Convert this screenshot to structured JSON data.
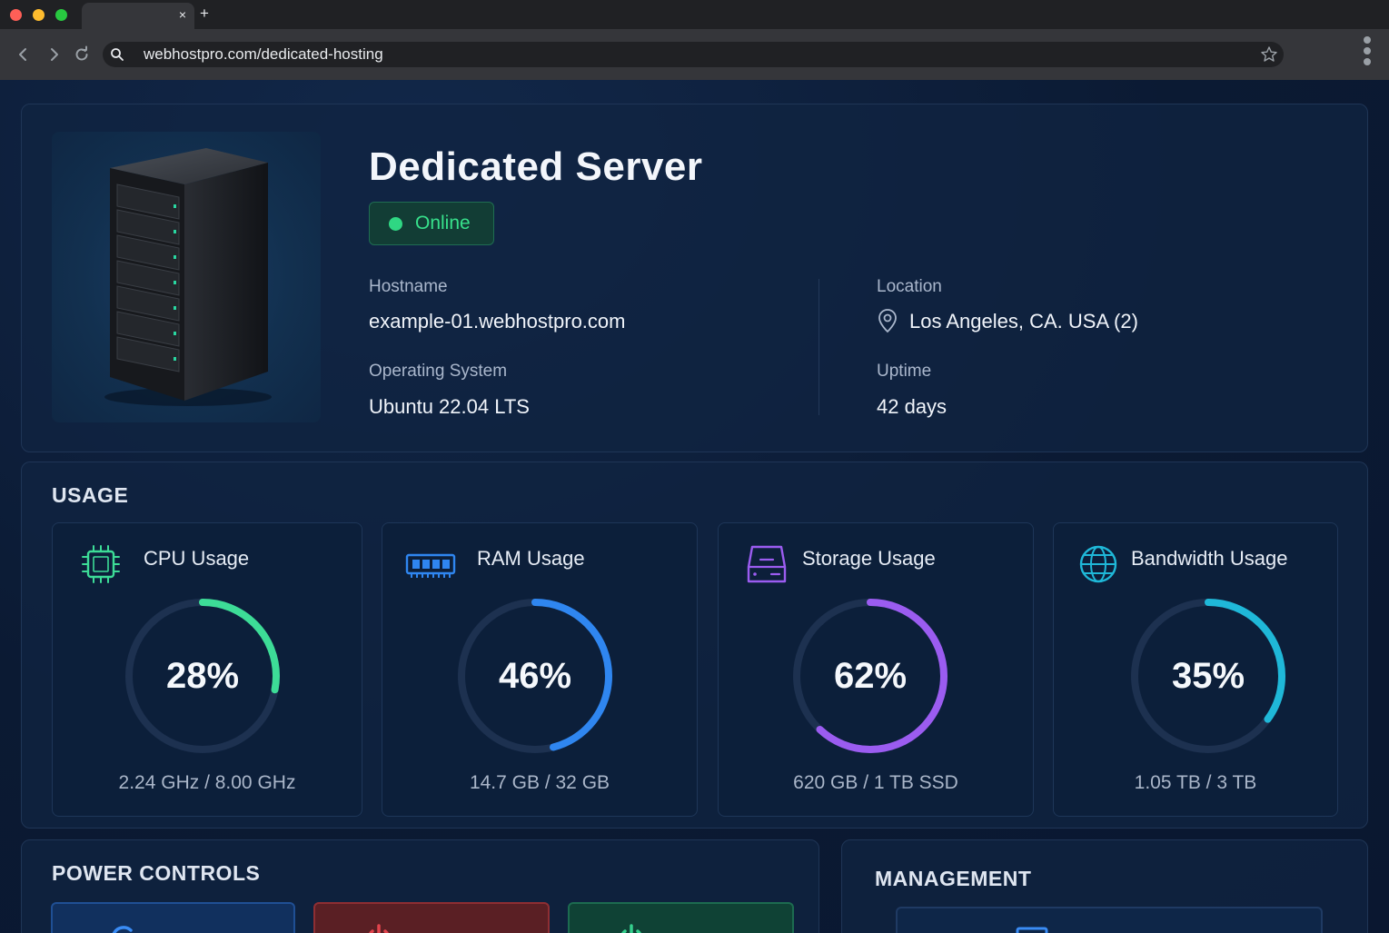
{
  "browser": {
    "tab_close": "×",
    "new_tab": "+",
    "url": "webhostpro.com/dedicated-hosting"
  },
  "server": {
    "title": "Dedicated Server",
    "status": "Online",
    "hostname_label": "Hostname",
    "hostname": "example-01.webhostpro.com",
    "os_label": "Operating System",
    "os": "Ubuntu 22.04 LTS",
    "location_label": "Location",
    "location": "Los Angeles, CA. USA (2)",
    "uptime_label": "Uptime",
    "uptime": "42 days"
  },
  "usage": {
    "title": "USAGE",
    "cards": [
      {
        "title": "CPU Usage",
        "percent_label": "28%",
        "fraction": 0.28,
        "detail": "2.24 GHz / 8.00 GHz",
        "color": "#3ddc97",
        "icon": "cpu-icon"
      },
      {
        "title": "RAM Usage",
        "percent_label": "46%",
        "fraction": 0.46,
        "detail": "14.7 GB / 32 GB",
        "color": "#2f86f0",
        "icon": "ram-icon"
      },
      {
        "title": "Storage Usage",
        "percent_label": "62%",
        "fraction": 0.62,
        "detail": "620 GB / 1 TB SSD",
        "color": "#9b5cf0",
        "icon": "hard-drive-icon"
      },
      {
        "title": "Bandwidth Usage",
        "percent_label": "35%",
        "fraction": 0.35,
        "detail": "1.05 TB / 3 TB",
        "color": "#1fb8d8",
        "icon": "globe-icon"
      }
    ]
  },
  "power": {
    "title": "POWER CONTROLS"
  },
  "management": {
    "title": "MANAGEMENT"
  },
  "colors": {
    "online_green": "#37e08b",
    "page_bg": "#0b1a33"
  }
}
